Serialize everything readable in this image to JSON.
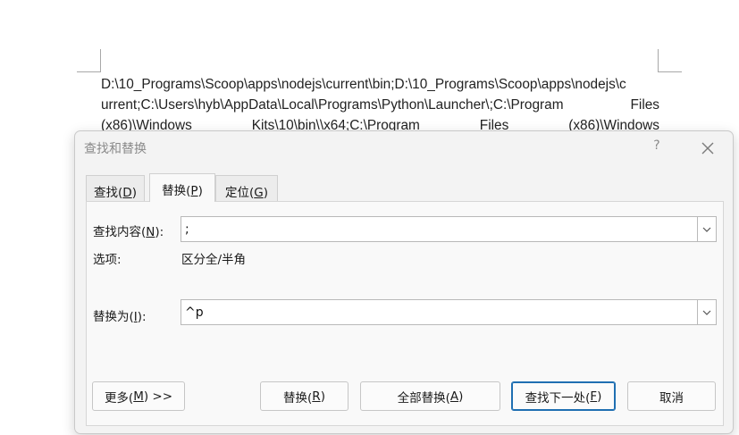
{
  "document": {
    "line1": "D:\\10_Programs\\Scoop\\apps\\nodejs\\current\\bin;D:\\10_Programs\\Scoop\\apps\\nodejs\\c",
    "line2": "urrent;C:\\Users\\hyb\\AppData\\Local\\Programs\\Python\\Launcher\\;C:\\Program",
    "line2_tail": "Files",
    "line3_parts": [
      "(x86)\\Windows",
      "Kits\\10\\bin\\\\x64;C:\\Program",
      "Files",
      "(x86)\\Windows"
    ]
  },
  "dialog": {
    "title": "查找和替换",
    "help_label": "?",
    "tabs": [
      {
        "label": "查找(",
        "mnemonic": "D",
        "suffix": ")",
        "active": false
      },
      {
        "label": "替换(",
        "mnemonic": "P",
        "suffix": ")",
        "active": true
      },
      {
        "label": "定位(",
        "mnemonic": "G",
        "suffix": ")",
        "active": false
      }
    ],
    "find": {
      "label_prefix": "查找内容(",
      "mnemonic": "N",
      "label_suffix": "):",
      "value": ";"
    },
    "options": {
      "label": "选项:",
      "value": "区分全/半角"
    },
    "replace": {
      "label_prefix": "替换为(",
      "mnemonic": "I",
      "label_suffix": "):",
      "value": "^p"
    },
    "buttons": {
      "more": {
        "prefix": "更多(",
        "mnemonic": "M",
        "suffix": ") >>"
      },
      "replace": {
        "prefix": "替换(",
        "mnemonic": "R",
        "suffix": ")"
      },
      "replace_all": {
        "prefix": "全部替换(",
        "mnemonic": "A",
        "suffix": ")"
      },
      "find_next": {
        "prefix": "查找下一处(",
        "mnemonic": "F",
        "suffix": ")"
      },
      "cancel": {
        "label": "取消"
      }
    }
  },
  "colors": {
    "dialog_bg": "#f3f3f3",
    "accent_border": "#1f6fb2"
  }
}
